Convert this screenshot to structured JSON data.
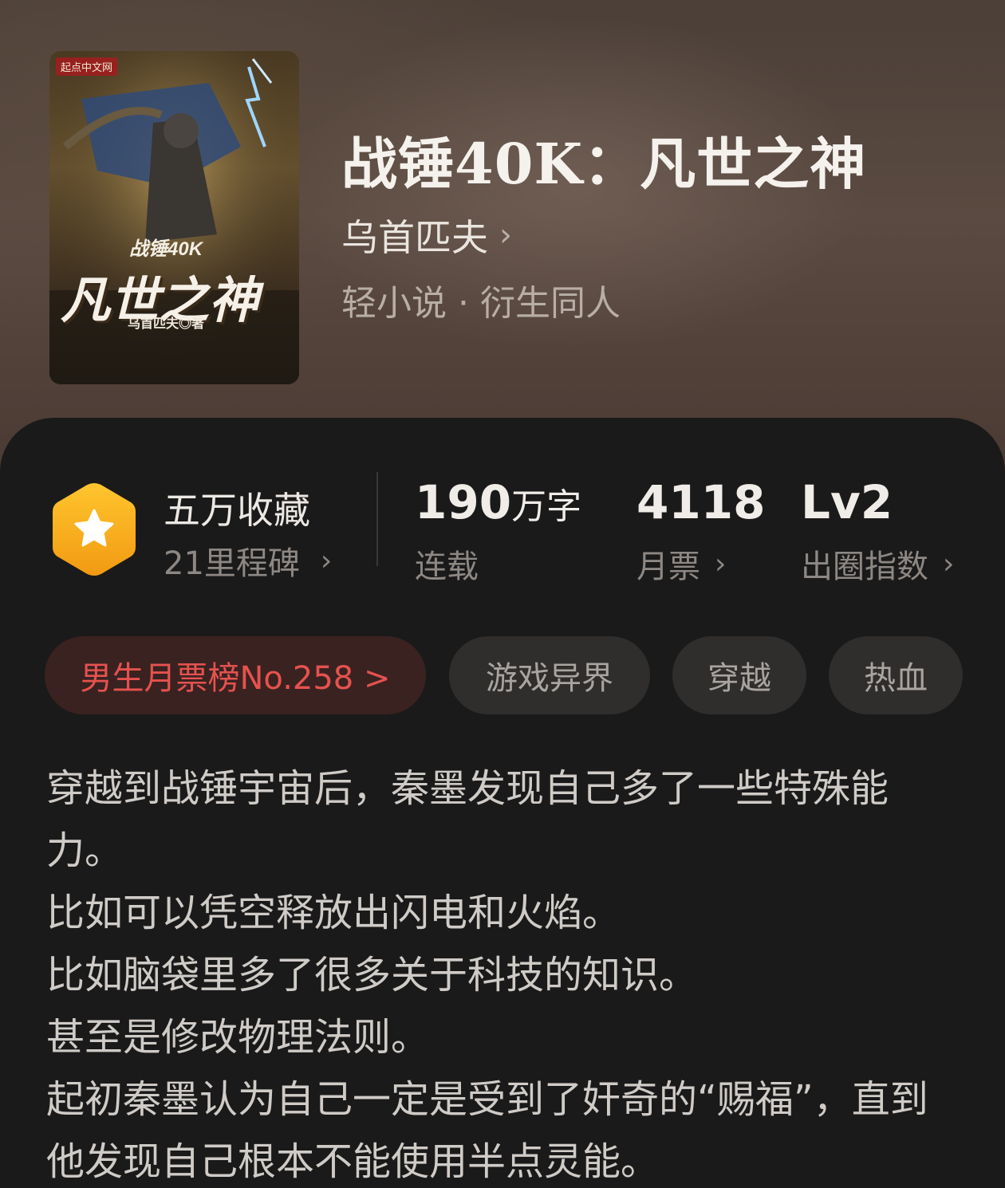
{
  "book": {
    "title": "战锤40K：凡世之神",
    "author": "乌首匹夫",
    "genre": "轻小说 · 衍生同人",
    "cover": {
      "publisher_logo": "起点中文网",
      "title_small": "战锤40K",
      "title_large": "凡世之神",
      "author_credit": "乌首匹夫◎著"
    }
  },
  "stats": {
    "favorites": {
      "label": "五万收藏",
      "sub": "21里程碑",
      "icon": "star-icon"
    },
    "words": {
      "number": "190",
      "unit": "万字",
      "label": "连载"
    },
    "monthly_votes": {
      "number": "4118",
      "label": "月票"
    },
    "influence": {
      "number": "Lv2",
      "label": "出圈指数"
    }
  },
  "tags": [
    {
      "label": "男生月票榜No.258 >"
    },
    {
      "label": "游戏异界"
    },
    {
      "label": "穿越"
    },
    {
      "label": "热血"
    }
  ],
  "description": [
    "穿越到战锤宇宙后，秦墨发现自己多了一些特殊能力。",
    "比如可以凭空释放出闪电和火焰。",
    "比如脑袋里多了很多关于科技的知识。",
    "甚至是修改物理法则。",
    "起初秦墨认为自己一定是受到了奸奇的“赐福”，直到他发现自己根本不能使用半点灵能。"
  ],
  "colors": {
    "accent_red": "#e5524e",
    "badge_orange": "#f7a51c",
    "panel_bg": "#1b1a1a"
  }
}
